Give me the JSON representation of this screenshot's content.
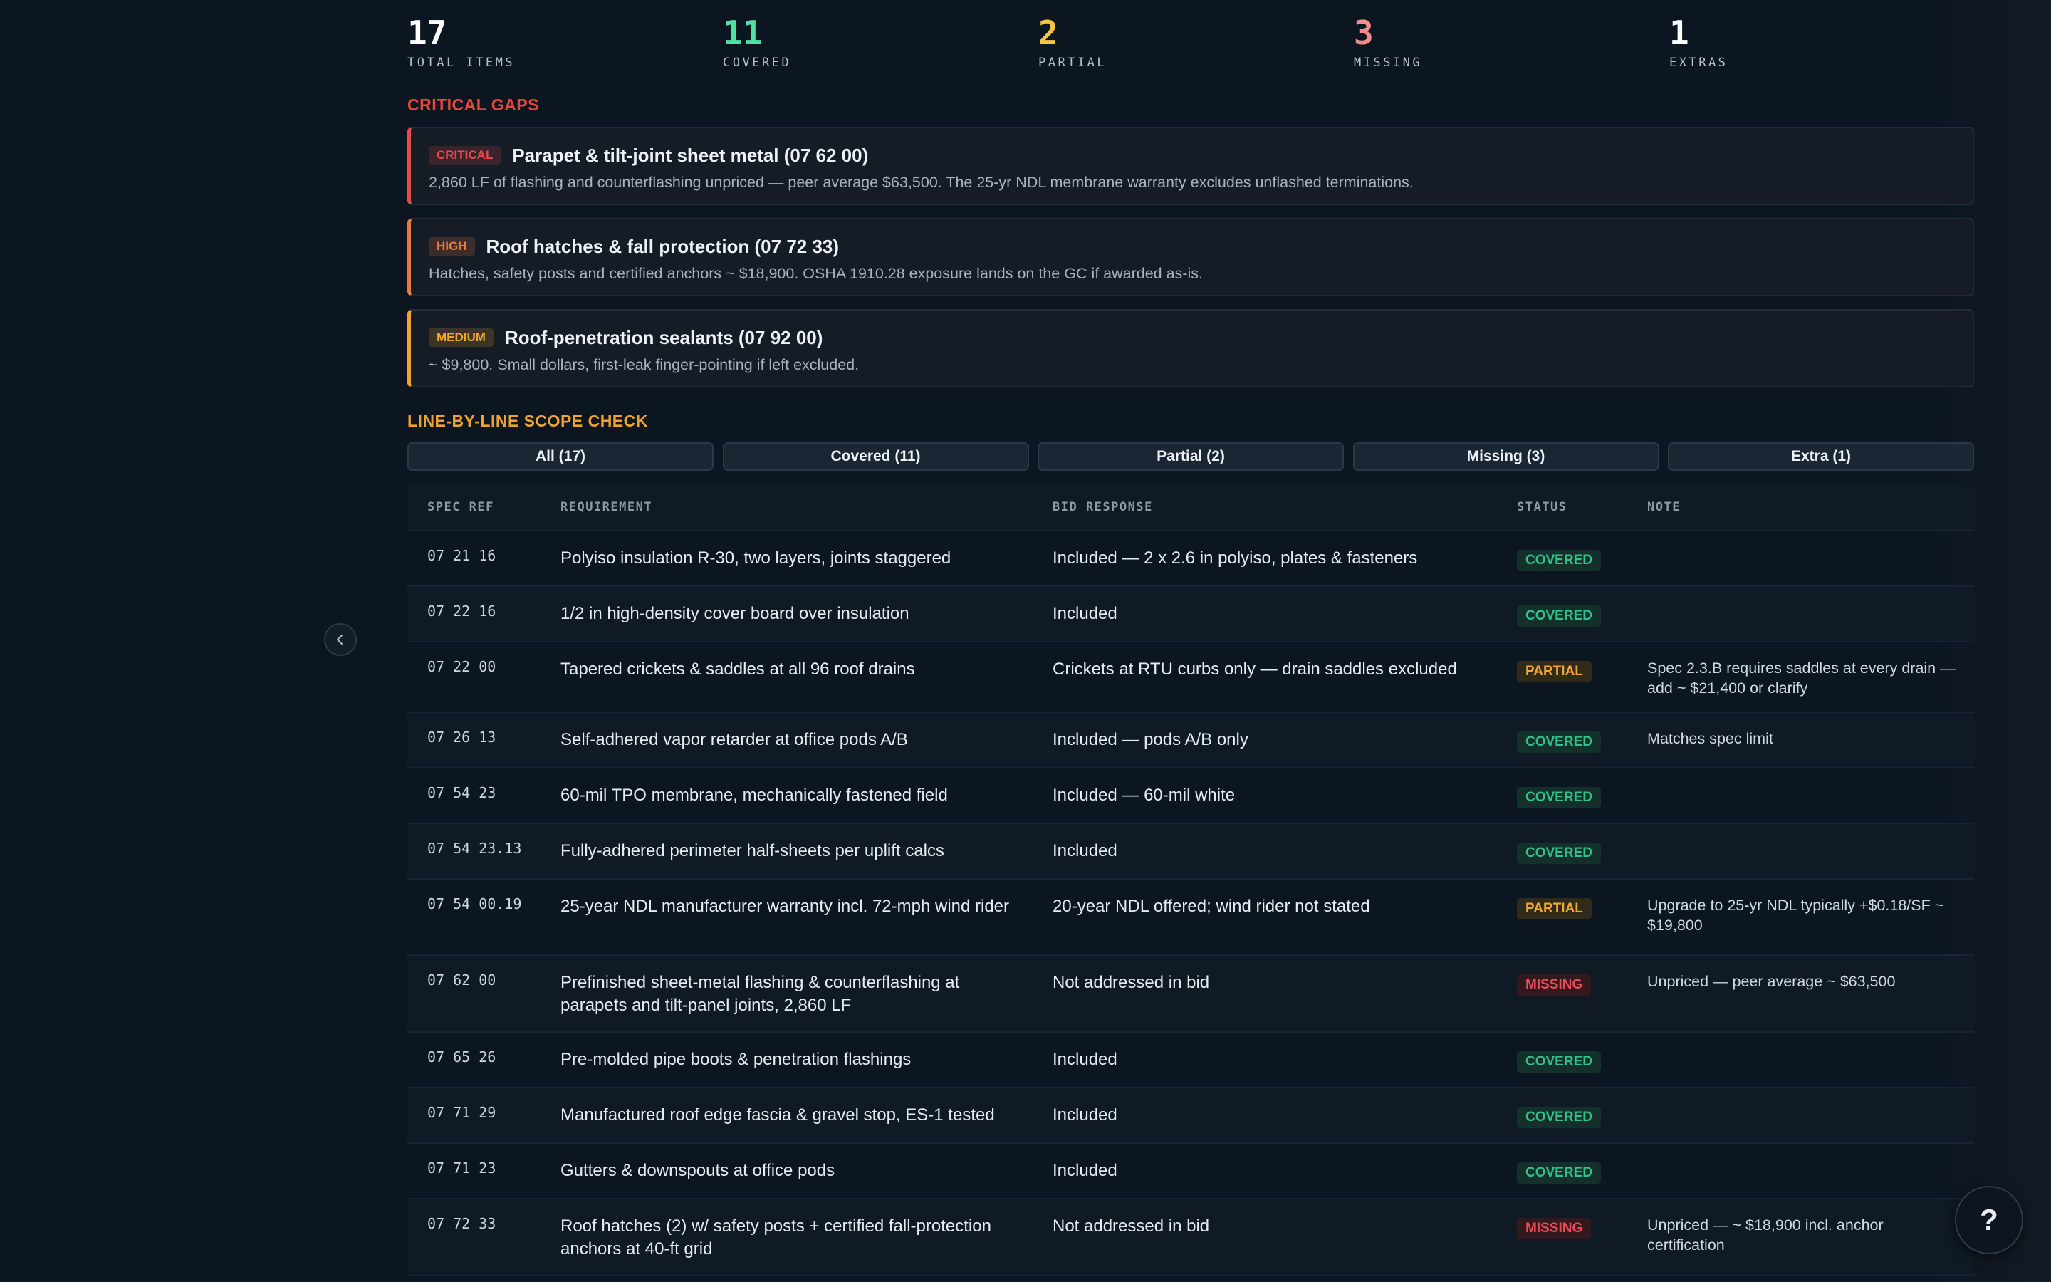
{
  "stats": [
    {
      "value": "17",
      "label": "TOTAL ITEMS",
      "color": "#ffffff"
    },
    {
      "value": "11",
      "label": "COVERED",
      "color": "#4ee1a6"
    },
    {
      "value": "2",
      "label": "PARTIAL",
      "color": "#f5c542"
    },
    {
      "value": "3",
      "label": "MISSING",
      "color": "#f38c8c"
    },
    {
      "value": "1",
      "label": "EXTRAS",
      "color": "#ffffff"
    }
  ],
  "critical_gaps": {
    "title": "CRITICAL GAPS",
    "color": "#e8473f",
    "items": [
      {
        "tag": "CRITICAL",
        "title": "Parapet & tilt-joint sheet metal (07 62 00)",
        "desc": "2,860 LF of flashing and counterflashing unpriced — peer average $63,500. The 25-yr NDL membrane warranty excludes unflashed terminations.",
        "color": "#e84a4a"
      },
      {
        "tag": "HIGH",
        "title": "Roof hatches & fall protection (07 72 33)",
        "desc": "Hatches, safety posts and certified anchors ~ $18,900. OSHA 1910.28 exposure lands on the GC if awarded as-is.",
        "color": "#ec7a3c"
      },
      {
        "tag": "MEDIUM",
        "title": "Roof-penetration sealants (07 92 00)",
        "desc": "~ $9,800. Small dollars, first-leak finger-pointing if left excluded.",
        "color": "#f0a62b"
      }
    ]
  },
  "scope_check": {
    "title": "LINE-BY-LINE SCOPE CHECK",
    "color": "#f0a230",
    "filters": [
      "All (17)",
      "Covered (11)",
      "Partial (2)",
      "Missing (3)",
      "Extra (1)"
    ],
    "columns": [
      "SPEC REF",
      "REQUIREMENT",
      "BID RESPONSE",
      "STATUS",
      "NOTE"
    ],
    "rows": [
      {
        "ref": "07 21 16",
        "req": "Polyiso insulation R-30, two layers, joints staggered",
        "bid": "Included — 2 x 2.6 in polyiso, plates & fasteners",
        "status": "COVERED",
        "note": ""
      },
      {
        "ref": "07 22 16",
        "req": "1/2 in high-density cover board over insulation",
        "bid": "Included",
        "status": "COVERED",
        "note": ""
      },
      {
        "ref": "07 22 00",
        "req": "Tapered crickets & saddles at all 96 roof drains",
        "bid": "Crickets at RTU curbs only — drain saddles excluded",
        "status": "PARTIAL",
        "note": "Spec 2.3.B requires saddles at every drain — add ~ $21,400 or clarify"
      },
      {
        "ref": "07 26 13",
        "req": "Self-adhered vapor retarder at office pods A/B",
        "bid": "Included — pods A/B only",
        "status": "COVERED",
        "note": "Matches spec limit"
      },
      {
        "ref": "07 54 23",
        "req": "60-mil TPO membrane, mechanically fastened field",
        "bid": "Included — 60-mil white",
        "status": "COVERED",
        "note": ""
      },
      {
        "ref": "07 54 23.13",
        "req": "Fully-adhered perimeter half-sheets per uplift calcs",
        "bid": "Included",
        "status": "COVERED",
        "note": ""
      },
      {
        "ref": "07 54 00.19",
        "req": "25-year NDL manufacturer warranty incl. 72-mph wind rider",
        "bid": "20-year NDL offered; wind rider not stated",
        "status": "PARTIAL",
        "note": "Upgrade to 25-yr NDL typically +$0.18/SF ~ $19,800"
      },
      {
        "ref": "07 62 00",
        "req": "Prefinished sheet-metal flashing & counterflashing at parapets and tilt-panel joints, 2,860 LF",
        "bid": "Not addressed in bid",
        "status": "MISSING",
        "note": "Unpriced — peer average ~ $63,500"
      },
      {
        "ref": "07 65 26",
        "req": "Pre-molded pipe boots & penetration flashings",
        "bid": "Included",
        "status": "COVERED",
        "note": ""
      },
      {
        "ref": "07 71 29",
        "req": "Manufactured roof edge fascia & gravel stop, ES-1 tested",
        "bid": "Included",
        "status": "COVERED",
        "note": ""
      },
      {
        "ref": "07 71 23",
        "req": "Gutters & downspouts at office pods",
        "bid": "Included",
        "status": "COVERED",
        "note": ""
      },
      {
        "ref": "07 72 33",
        "req": "Roof hatches (2) w/ safety posts + certified fall-protection anchors at 40-ft grid",
        "bid": "Not addressed in bid",
        "status": "MISSING",
        "note": "Unpriced — ~ $18,900 incl. anchor certification"
      }
    ]
  },
  "icons": {
    "collapse": "chevron-left-icon",
    "help": "question-mark-icon"
  },
  "help_label": "?"
}
